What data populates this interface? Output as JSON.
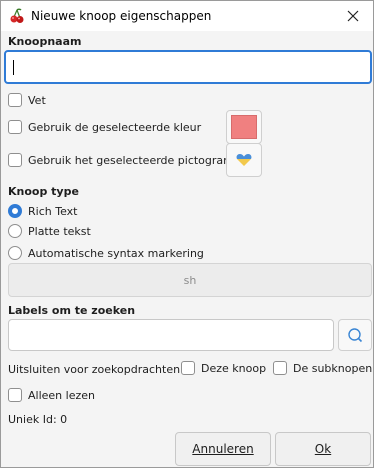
{
  "window": {
    "title": "Nieuwe knoop eigenschappen",
    "app_icon": "cherry-icon",
    "close_icon": "close-icon"
  },
  "name_section": {
    "label": "Knoopnaam",
    "input_value": ""
  },
  "options": {
    "bold_label": "Vet",
    "use_color_label": "Gebruik de geselecteerde kleur",
    "color_value": "#f08080",
    "use_icon_label": "Gebruik het geselecteerde pictogram",
    "icon_name": "heart-icon"
  },
  "node_type": {
    "label": "Knoop type",
    "options": [
      {
        "label": "Rich Text",
        "checked": true
      },
      {
        "label": "Platte tekst",
        "checked": false
      },
      {
        "label": "Automatische syntax markering",
        "checked": false
      }
    ],
    "syntax_button_label": "sh"
  },
  "tags": {
    "label": "Labels om te zoeken",
    "input_value": "",
    "search_icon": "search-icon"
  },
  "exclude": {
    "label": "Uitsluiten voor zoekopdrachten",
    "this_node_label": "Deze knoop",
    "subnodes_label": "De subknopen"
  },
  "readonly_label": "Alleen lezen",
  "unique_id": "Uniek Id: 0",
  "buttons": {
    "cancel": "Annuleren",
    "ok": "Ok"
  },
  "colors": {
    "accent": "#2f7bd6",
    "swatch": "#f08080"
  }
}
